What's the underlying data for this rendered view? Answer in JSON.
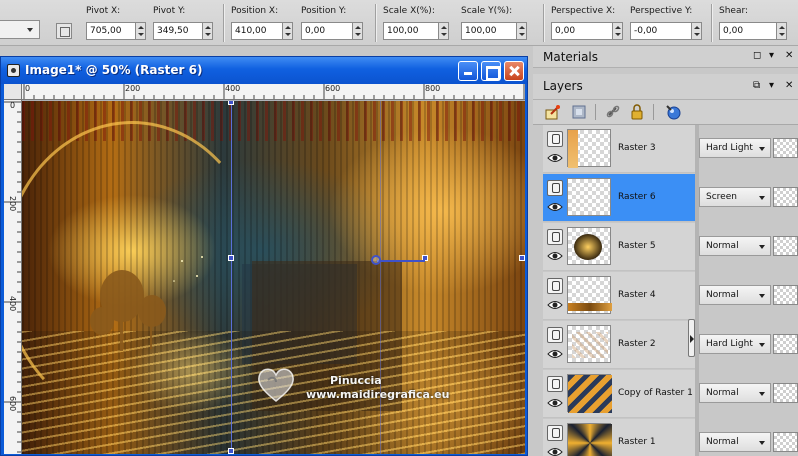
{
  "toolbar": {
    "fields": [
      {
        "label": "Pivot X:",
        "value": "705,00"
      },
      {
        "label": "Pivot Y:",
        "value": "349,50"
      },
      {
        "label": "Position X:",
        "value": "410,00"
      },
      {
        "label": "Position Y:",
        "value": "0,00"
      },
      {
        "label": "Scale X(%):",
        "value": "100,00"
      },
      {
        "label": "Scale Y(%):",
        "value": "100,00"
      },
      {
        "label": "Perspective X:",
        "value": "0,00"
      },
      {
        "label": "Perspective Y:",
        "value": "-0,00"
      },
      {
        "label": "Shear:",
        "value": "0,00"
      }
    ]
  },
  "image_window": {
    "title": "Image1* @  50% (Raster 6)",
    "ruler_h": [
      "0",
      "200",
      "400",
      "600",
      "800"
    ],
    "ruler_v": [
      "0",
      "200",
      "400",
      "600"
    ],
    "watermark_name": "Pinuccia",
    "watermark_url": "www.maidiregrafica.eu"
  },
  "materials_panel": {
    "title": "Materials",
    "pin": "⬜",
    "menu": "▾",
    "close": "✖"
  },
  "layers_panel": {
    "title": "Layers",
    "layers": [
      {
        "name": "Raster 3",
        "blend": "Hard Light",
        "selected": false
      },
      {
        "name": "Raster 6",
        "blend": "Screen",
        "selected": true
      },
      {
        "name": "Raster 5",
        "blend": "Normal",
        "selected": false
      },
      {
        "name": "Raster 4",
        "blend": "Normal",
        "selected": false
      },
      {
        "name": "Raster 2",
        "blend": "Hard Light",
        "selected": false
      },
      {
        "name": "Copy of Raster 1",
        "blend": "Normal",
        "selected": false
      },
      {
        "name": "Raster 1",
        "blend": "Normal",
        "selected": false
      }
    ]
  },
  "colors": {
    "selected": "#3b8ff5",
    "titlebar": "#1060e0",
    "guide": "#3f52c8"
  }
}
